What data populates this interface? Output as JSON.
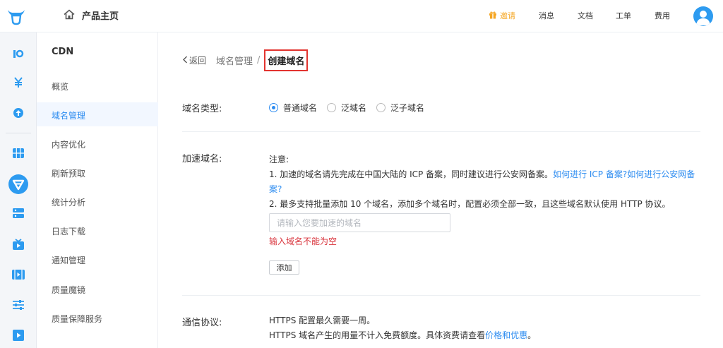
{
  "header": {
    "home_label": "产品主页",
    "invite_label": "邀请",
    "messages_label": "消息",
    "docs_label": "文档",
    "ticket_label": "工单",
    "fees_label": "费用",
    "logo_icon": "bull-logo-icon",
    "home_icon": "home-icon",
    "invite_icon": "gift-icon",
    "avatar_icon": "user-avatar-icon",
    "accent_color": "#2d9bf0",
    "invite_color": "#f5a623"
  },
  "rail": {
    "icons": [
      "rocket-icon",
      "yen-icon",
      "upload-icon",
      "grid-icon",
      "cdn-icon",
      "storage-icon",
      "live-video-icon",
      "media-processing-icon",
      "sliders-icon",
      "vod-icon"
    ]
  },
  "sidebar": {
    "title": "CDN",
    "items": [
      {
        "label": "概览",
        "active": false
      },
      {
        "label": "域名管理",
        "active": true
      },
      {
        "label": "内容优化",
        "active": false
      },
      {
        "label": "刷新预取",
        "active": false
      },
      {
        "label": "统计分析",
        "active": false
      },
      {
        "label": "日志下载",
        "active": false
      },
      {
        "label": "通知管理",
        "active": false
      },
      {
        "label": "质量魔镜",
        "active": false
      },
      {
        "label": "质量保障服务",
        "active": false
      }
    ]
  },
  "breadcrumb": {
    "back_label": "返回",
    "parent_label": "域名管理",
    "separator": "/",
    "current_label": "创建域名"
  },
  "form": {
    "domain_type": {
      "label": "域名类型:",
      "options": [
        {
          "label": "普通域名",
          "selected": true
        },
        {
          "label": "泛域名",
          "selected": false
        },
        {
          "label": "泛子域名",
          "selected": false
        }
      ]
    },
    "accel_domain": {
      "label": "加速域名:",
      "note_title": "注意:",
      "note1_text": "1. 加速的域名请先完成在中国大陆的 ICP 备案，同时建议进行公安网备案。",
      "note1_link1": "如何进行 ICP 备案?",
      "note1_link2": "如何进行公安网备案?",
      "note2_text": "2. 最多支持批量添加 10 个域名，添加多个域名时，配置必须全部一致，且这些域名默认使用 HTTP 协议。",
      "input_value": "",
      "input_placeholder": "请输入您要加速的域名",
      "error_text": "输入域名不能为空",
      "add_button_label": "添加"
    },
    "protocol": {
      "label": "通信协议:",
      "line1": "HTTPS 配置最久需要一周。",
      "line2_text": "HTTPS 域名产生的用量不计入免费额度。具体资费请查看",
      "line2_link": "价格和优惠",
      "line2_end": "。"
    }
  }
}
